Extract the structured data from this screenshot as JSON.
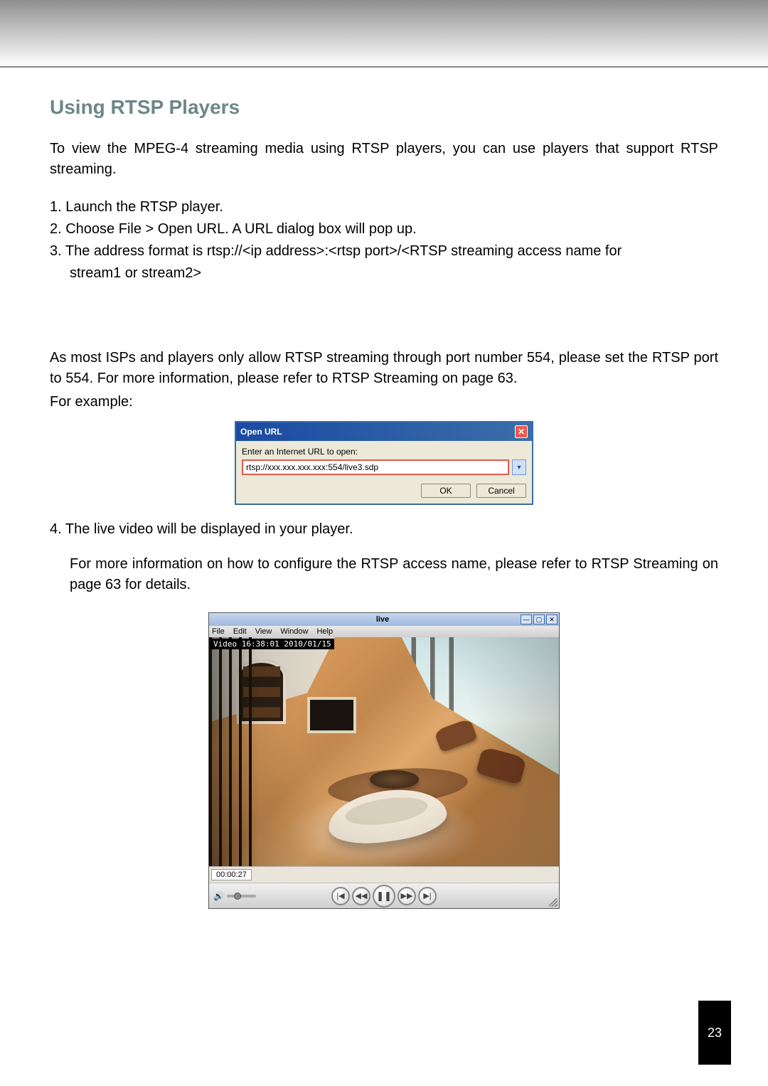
{
  "heading": "Using RTSP Players",
  "intro": "To view the MPEG-4 streaming media using RTSP players, you can use players that support RTSP streaming.",
  "steps": {
    "s1": "1. Launch the RTSP player.",
    "s2": "2. Choose File > Open URL. A URL dialog box will pop up.",
    "s3a": "3. The address format is rtsp://<ip address>:<rtsp port>/<RTSP streaming access name for",
    "s3b": "stream1 or stream2>"
  },
  "mid1": "As most ISPs and players only allow RTSP streaming through port number 554, please set the RTSP port to 554. For more information, please refer to RTSP Streaming on page 63.",
  "mid2": "For example:",
  "dialog": {
    "title": "Open URL",
    "label": "Enter an Internet URL to open:",
    "value_a": "rtsp://xxx.xxx.xxx.xxx:554/",
    "value_b": "live3.sdp",
    "ok": "OK",
    "cancel": "Cancel"
  },
  "step4a": "4. The live video will be displayed in your player.",
  "step4b": "For more information on how to configure the RTSP access name, please refer to RTSP Streaming on page 63 for details.",
  "player": {
    "title": "live",
    "menu": {
      "file": "File",
      "edit": "Edit",
      "view": "View",
      "window": "Window",
      "help": "Help"
    },
    "timestamp": "Video 16:38:01 2010/01/15",
    "progress": "00:00:27"
  },
  "page_number": "23"
}
